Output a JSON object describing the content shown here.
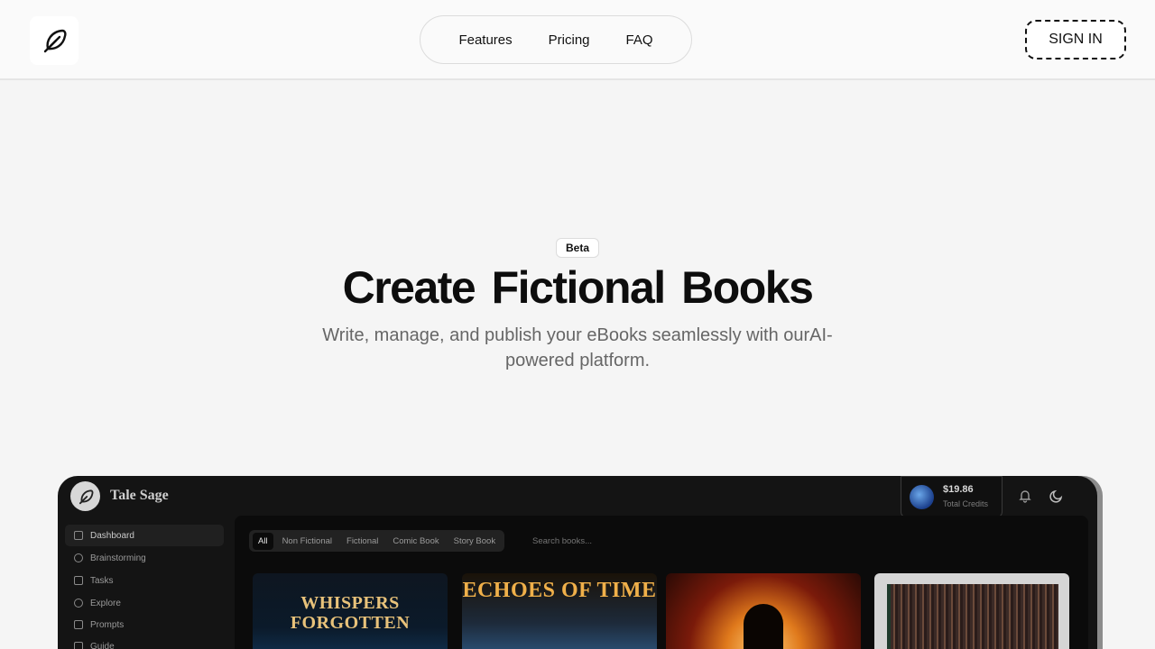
{
  "header": {
    "nav": [
      "Features",
      "Pricing",
      "FAQ"
    ],
    "signin_label": "SIGN IN"
  },
  "hero": {
    "badge": "Beta",
    "title": "Create Fictional Books",
    "subtitle": "Write, manage, and publish your eBooks seamlessly with ourAI-powered platform."
  },
  "preview": {
    "app_name": "Tale Sage",
    "credits_amount": "$19.86",
    "credits_label": "Total Credits",
    "sidebar": [
      "Dashboard",
      "Brainstorming",
      "Tasks",
      "Explore",
      "Prompts",
      "Guide"
    ],
    "filters": [
      "All",
      "Non Fictional",
      "Fictional",
      "Comic Book",
      "Story Book"
    ],
    "search_placeholder": "Search books...",
    "covers": [
      "WHISPERS FORGOTTEN",
      "ECHOES OF TIME"
    ]
  }
}
